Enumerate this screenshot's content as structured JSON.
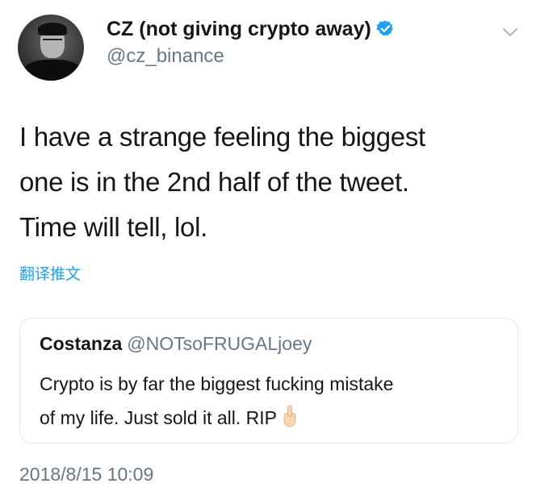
{
  "author": {
    "display_name": "CZ (not giving crypto away)",
    "handle": "@cz_binance",
    "verified": true,
    "avatar_icon": "profile-photo"
  },
  "tweet": {
    "text_lines": [
      "I have a strange feeling the biggest",
      "one is in the 2nd half of the tweet.",
      "Time will tell, lol."
    ],
    "translate_label": "翻译推文",
    "timestamp": "2018/8/15 10:09"
  },
  "quoted_tweet": {
    "display_name": "Costanza",
    "handle": "@NOTsoFRUGALjoey",
    "text_lines": [
      "Crypto is by far the biggest fucking mistake",
      "of my life. Just sold it all. RIP"
    ],
    "emoji_icon": "middle-finger-emoji"
  },
  "colors": {
    "text": "#14171a",
    "secondary": "#657786",
    "accent": "#1da1f2",
    "border": "#e1e8ed"
  },
  "icons": {
    "verified": "verified-badge-icon",
    "menu": "chevron-down-icon"
  }
}
